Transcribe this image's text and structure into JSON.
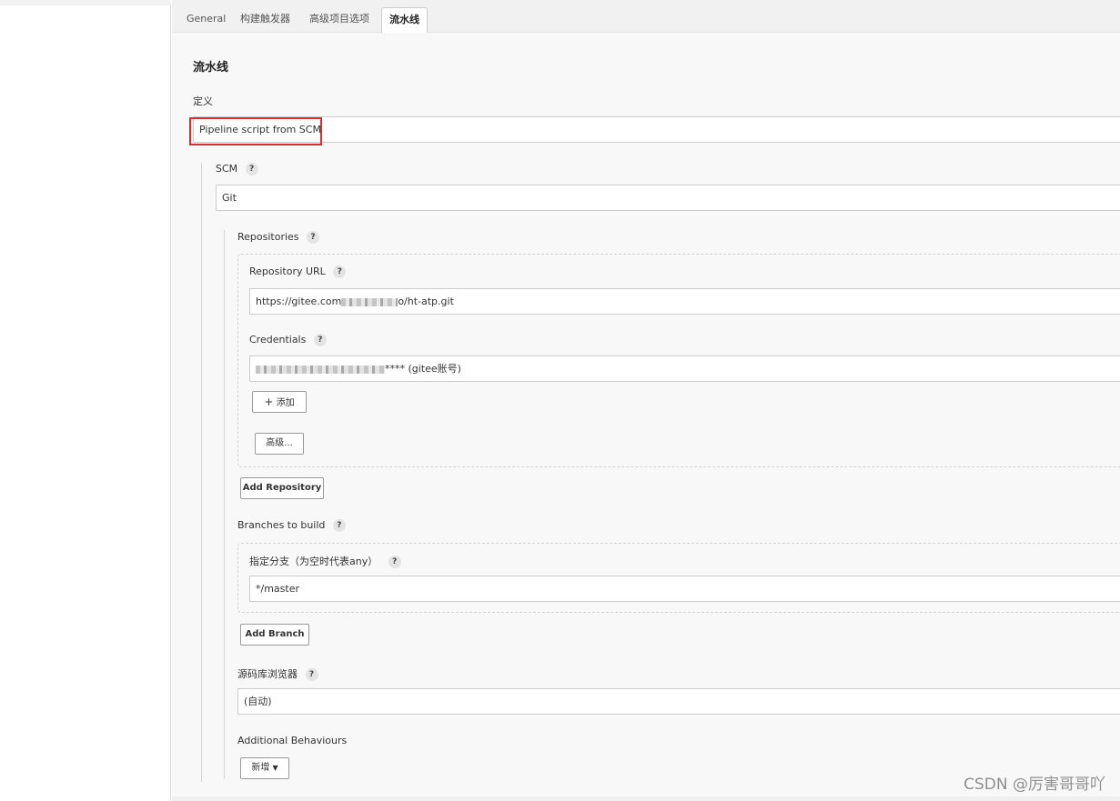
{
  "tabs": [
    "General",
    "构建触发器",
    "高级项目选项",
    "流水线"
  ],
  "active_tab": "流水线",
  "section_title": "流水线",
  "definition": {
    "label": "定义",
    "value": "Pipeline script from SCM"
  },
  "scm": {
    "label": "SCM",
    "value": "Git",
    "help": "?"
  },
  "repositories": {
    "label": "Repositories",
    "url_label": "Repository URL",
    "url_prefix": "https://gitee.com",
    "url_suffix": "o/ht-atp.git",
    "credentials_label": "Credentials",
    "credentials_suffix": "**** (gitee账号)",
    "add_button": "添加",
    "advanced_button": "高级...",
    "add_repository_button": "Add Repository"
  },
  "branches": {
    "label": "Branches to build",
    "specifier_label": "指定分支（为空时代表any）",
    "specifier_value": "*/master",
    "add_branch_button": "Add Branch"
  },
  "browser": {
    "label": "源码库浏览器",
    "value": "(自动)"
  },
  "behaviours": {
    "label": "Additional Behaviours",
    "add_button": "新增"
  },
  "watermark": "CSDN @厉害哥哥吖"
}
